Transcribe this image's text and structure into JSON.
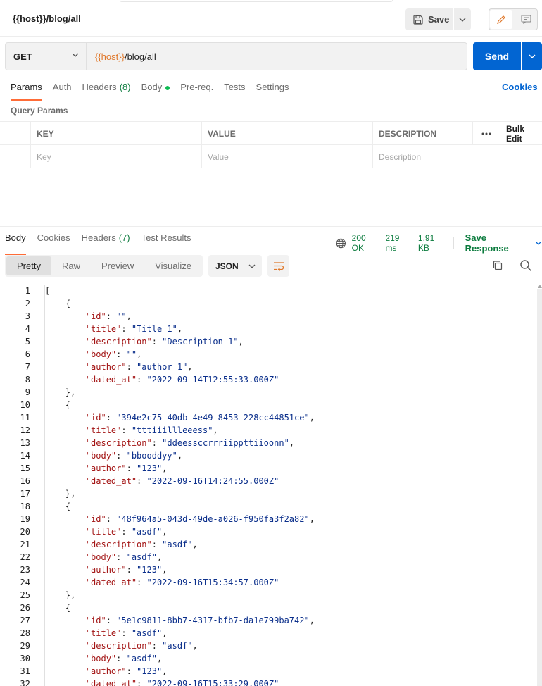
{
  "request": {
    "title": "{{host}}/blog/all",
    "save_label": "Save",
    "method": "GET",
    "url_var": "{{host}}",
    "url_path": "/blog/all",
    "send_label": "Send"
  },
  "request_tabs": [
    {
      "label": "Params"
    },
    {
      "label": "Auth"
    },
    {
      "label": "Headers",
      "count": "(8)"
    },
    {
      "label": "Body"
    },
    {
      "label": "Pre-req."
    },
    {
      "label": "Tests"
    },
    {
      "label": "Settings"
    }
  ],
  "cookies_label": "Cookies",
  "query_params": {
    "title": "Query Params",
    "headers": [
      "KEY",
      "VALUE",
      "DESCRIPTION",
      "Bulk Edit"
    ],
    "placeholders": [
      "Key",
      "Value",
      "Description"
    ]
  },
  "response": {
    "tabs": [
      {
        "label": "Body"
      },
      {
        "label": "Cookies"
      },
      {
        "label": "Headers",
        "count": "(7)"
      },
      {
        "label": "Test Results"
      }
    ],
    "status": "200 OK",
    "time": "219 ms",
    "size": "1.91 KB",
    "save_response": "Save Response",
    "view_tabs": [
      "Pretty",
      "Raw",
      "Preview",
      "Visualize"
    ],
    "format": "JSON"
  },
  "colors": {
    "accent": "#ff6c37",
    "primary": "#0265d2",
    "success": "#0d7c3f"
  },
  "code_lines": [
    "[",
    "    {",
    "        \"id\": \"\",",
    "        \"title\": \"Title 1\",",
    "        \"description\": \"Description 1\",",
    "        \"body\": \"\",",
    "        \"author\": \"author 1\",",
    "        \"dated_at\": \"2022-09-14T12:55:33.000Z\"",
    "    },",
    "    {",
    "        \"id\": \"394e2c75-40db-4e49-8453-228cc44851ce\",",
    "        \"title\": \"tttiiillleeess\",",
    "        \"description\": \"ddeessccrrriippttiioonn\",",
    "        \"body\": \"bbooddyy\",",
    "        \"author\": \"123\",",
    "        \"dated_at\": \"2022-09-16T14:24:55.000Z\"",
    "    },",
    "    {",
    "        \"id\": \"48f964a5-043d-49de-a026-f950fa3f2a82\",",
    "        \"title\": \"asdf\",",
    "        \"description\": \"asdf\",",
    "        \"body\": \"asdf\",",
    "        \"author\": \"123\",",
    "        \"dated_at\": \"2022-09-16T15:34:57.000Z\"",
    "    },",
    "    {",
    "        \"id\": \"5e1c9811-8bb7-4317-bfb7-da1e799ba742\",",
    "        \"title\": \"asdf\",",
    "        \"description\": \"asdf\",",
    "        \"body\": \"asdf\",",
    "        \"author\": \"123\",",
    "        \"dated_at\": \"2022-09-16T15:33:29.000Z\""
  ]
}
